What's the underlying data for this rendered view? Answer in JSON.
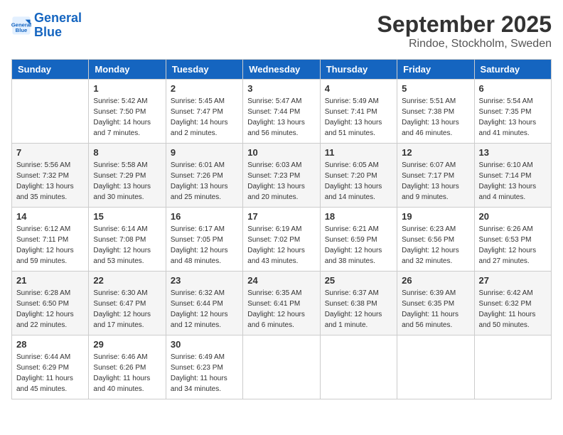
{
  "header": {
    "logo_line1": "General",
    "logo_line2": "Blue",
    "month": "September 2025",
    "location": "Rindoe, Stockholm, Sweden"
  },
  "weekdays": [
    "Sunday",
    "Monday",
    "Tuesday",
    "Wednesday",
    "Thursday",
    "Friday",
    "Saturday"
  ],
  "weeks": [
    [
      {
        "day": "",
        "info": ""
      },
      {
        "day": "1",
        "info": "Sunrise: 5:42 AM\nSunset: 7:50 PM\nDaylight: 14 hours\nand 7 minutes."
      },
      {
        "day": "2",
        "info": "Sunrise: 5:45 AM\nSunset: 7:47 PM\nDaylight: 14 hours\nand 2 minutes."
      },
      {
        "day": "3",
        "info": "Sunrise: 5:47 AM\nSunset: 7:44 PM\nDaylight: 13 hours\nand 56 minutes."
      },
      {
        "day": "4",
        "info": "Sunrise: 5:49 AM\nSunset: 7:41 PM\nDaylight: 13 hours\nand 51 minutes."
      },
      {
        "day": "5",
        "info": "Sunrise: 5:51 AM\nSunset: 7:38 PM\nDaylight: 13 hours\nand 46 minutes."
      },
      {
        "day": "6",
        "info": "Sunrise: 5:54 AM\nSunset: 7:35 PM\nDaylight: 13 hours\nand 41 minutes."
      }
    ],
    [
      {
        "day": "7",
        "info": "Sunrise: 5:56 AM\nSunset: 7:32 PM\nDaylight: 13 hours\nand 35 minutes."
      },
      {
        "day": "8",
        "info": "Sunrise: 5:58 AM\nSunset: 7:29 PM\nDaylight: 13 hours\nand 30 minutes."
      },
      {
        "day": "9",
        "info": "Sunrise: 6:01 AM\nSunset: 7:26 PM\nDaylight: 13 hours\nand 25 minutes."
      },
      {
        "day": "10",
        "info": "Sunrise: 6:03 AM\nSunset: 7:23 PM\nDaylight: 13 hours\nand 20 minutes."
      },
      {
        "day": "11",
        "info": "Sunrise: 6:05 AM\nSunset: 7:20 PM\nDaylight: 13 hours\nand 14 minutes."
      },
      {
        "day": "12",
        "info": "Sunrise: 6:07 AM\nSunset: 7:17 PM\nDaylight: 13 hours\nand 9 minutes."
      },
      {
        "day": "13",
        "info": "Sunrise: 6:10 AM\nSunset: 7:14 PM\nDaylight: 13 hours\nand 4 minutes."
      }
    ],
    [
      {
        "day": "14",
        "info": "Sunrise: 6:12 AM\nSunset: 7:11 PM\nDaylight: 12 hours\nand 59 minutes."
      },
      {
        "day": "15",
        "info": "Sunrise: 6:14 AM\nSunset: 7:08 PM\nDaylight: 12 hours\nand 53 minutes."
      },
      {
        "day": "16",
        "info": "Sunrise: 6:17 AM\nSunset: 7:05 PM\nDaylight: 12 hours\nand 48 minutes."
      },
      {
        "day": "17",
        "info": "Sunrise: 6:19 AM\nSunset: 7:02 PM\nDaylight: 12 hours\nand 43 minutes."
      },
      {
        "day": "18",
        "info": "Sunrise: 6:21 AM\nSunset: 6:59 PM\nDaylight: 12 hours\nand 38 minutes."
      },
      {
        "day": "19",
        "info": "Sunrise: 6:23 AM\nSunset: 6:56 PM\nDaylight: 12 hours\nand 32 minutes."
      },
      {
        "day": "20",
        "info": "Sunrise: 6:26 AM\nSunset: 6:53 PM\nDaylight: 12 hours\nand 27 minutes."
      }
    ],
    [
      {
        "day": "21",
        "info": "Sunrise: 6:28 AM\nSunset: 6:50 PM\nDaylight: 12 hours\nand 22 minutes."
      },
      {
        "day": "22",
        "info": "Sunrise: 6:30 AM\nSunset: 6:47 PM\nDaylight: 12 hours\nand 17 minutes."
      },
      {
        "day": "23",
        "info": "Sunrise: 6:32 AM\nSunset: 6:44 PM\nDaylight: 12 hours\nand 12 minutes."
      },
      {
        "day": "24",
        "info": "Sunrise: 6:35 AM\nSunset: 6:41 PM\nDaylight: 12 hours\nand 6 minutes."
      },
      {
        "day": "25",
        "info": "Sunrise: 6:37 AM\nSunset: 6:38 PM\nDaylight: 12 hours\nand 1 minute."
      },
      {
        "day": "26",
        "info": "Sunrise: 6:39 AM\nSunset: 6:35 PM\nDaylight: 11 hours\nand 56 minutes."
      },
      {
        "day": "27",
        "info": "Sunrise: 6:42 AM\nSunset: 6:32 PM\nDaylight: 11 hours\nand 50 minutes."
      }
    ],
    [
      {
        "day": "28",
        "info": "Sunrise: 6:44 AM\nSunset: 6:29 PM\nDaylight: 11 hours\nand 45 minutes."
      },
      {
        "day": "29",
        "info": "Sunrise: 6:46 AM\nSunset: 6:26 PM\nDaylight: 11 hours\nand 40 minutes."
      },
      {
        "day": "30",
        "info": "Sunrise: 6:49 AM\nSunset: 6:23 PM\nDaylight: 11 hours\nand 34 minutes."
      },
      {
        "day": "",
        "info": ""
      },
      {
        "day": "",
        "info": ""
      },
      {
        "day": "",
        "info": ""
      },
      {
        "day": "",
        "info": ""
      }
    ]
  ]
}
